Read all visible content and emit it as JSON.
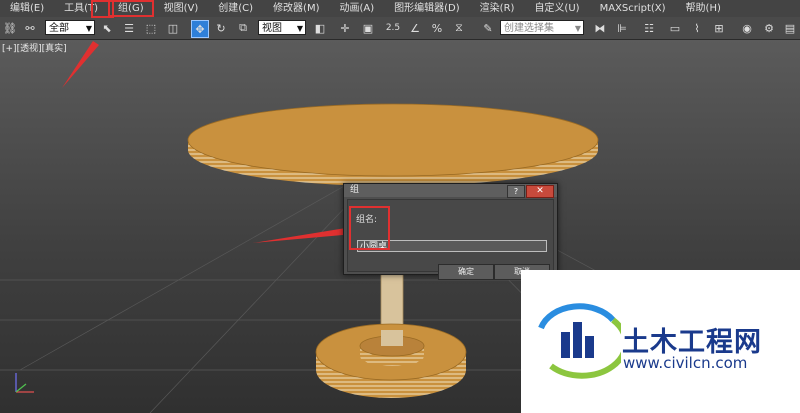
{
  "menubar": {
    "items": [
      "编辑(E)",
      "工具(T)",
      "组(G)",
      "视图(V)",
      "创建(C)",
      "修改器(M)",
      "动画(A)",
      "图形编辑器(D)",
      "渲染(R)",
      "自定义(U)",
      "MAXScript(X)",
      "帮助(H)"
    ],
    "active_index": 2
  },
  "toolbar": {
    "selection_filter": "全部",
    "reference_coord": "视图",
    "named_selection_placeholder": "创建选择集",
    "snap_angle": "2.5"
  },
  "viewport": {
    "label": "[+][透视][真实]"
  },
  "dialog": {
    "title": "组",
    "help_label": "?",
    "close_label": "✕",
    "name_label": "组名:",
    "name_value": "小圆桌",
    "ok_label": "确定",
    "cancel_label": "取消"
  },
  "colors": {
    "highlight_red": "#e03030",
    "table_wood": "#c9913e",
    "logo_blue": "#1a3a8c",
    "toolbar_active": "#2f7fd8"
  },
  "watermark": {
    "name": "土木工程网",
    "url": "www.civilcn.com"
  }
}
